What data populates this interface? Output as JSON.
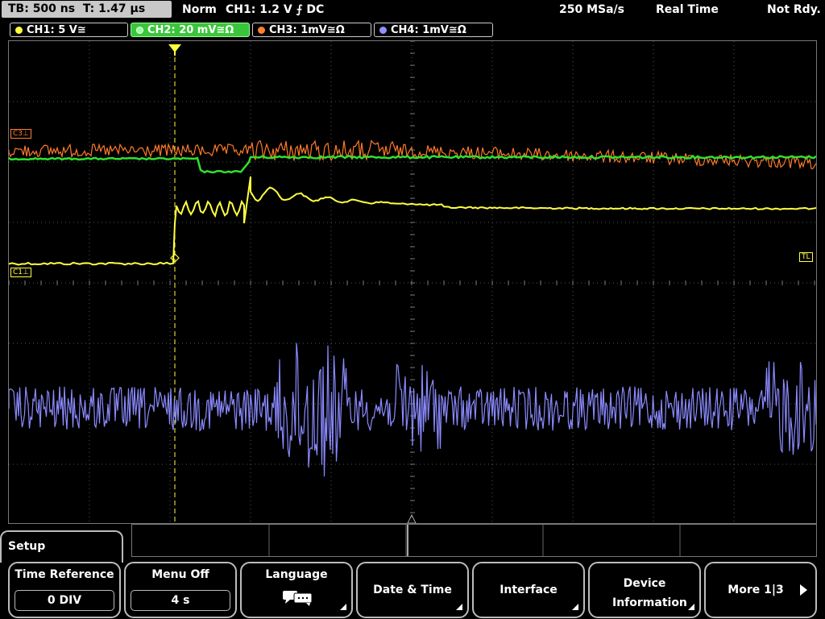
{
  "status": {
    "timebase": "TB: 500 ns",
    "trigger_time": "T: 1.47 µs",
    "mode": "Norm",
    "trigger": "CH1: 1.2 V ⨍ DC",
    "sample_rate": "250 MSa/s",
    "acq_mode": "Real Time",
    "state": "Not Rdy."
  },
  "channels": [
    {
      "label": "CH1: 5 V≅",
      "color": "#ffff40"
    },
    {
      "label": "CH2: 20 mV≅Ω",
      "color": "#40ff40"
    },
    {
      "label": "CH3: 1mV≅Ω",
      "color": "#ff8030"
    },
    {
      "label": "CH4: 1mV≅Ω",
      "color": "#9090ff"
    }
  ],
  "markers": {
    "c3": "C3⊥",
    "c1": "C1⊥",
    "tl": "TL",
    "trigger": "T"
  },
  "menu": {
    "title": "Setup",
    "keys": [
      {
        "label": "Time Reference",
        "value": "0 DIV"
      },
      {
        "label": "Menu Off",
        "value": "4 s"
      },
      {
        "label": "Language",
        "icon": "speech-bubble-icon"
      },
      {
        "label": "Date & Time"
      },
      {
        "label": "Interface"
      },
      {
        "label": "Device Information"
      },
      {
        "label": "More 1|3"
      }
    ]
  }
}
